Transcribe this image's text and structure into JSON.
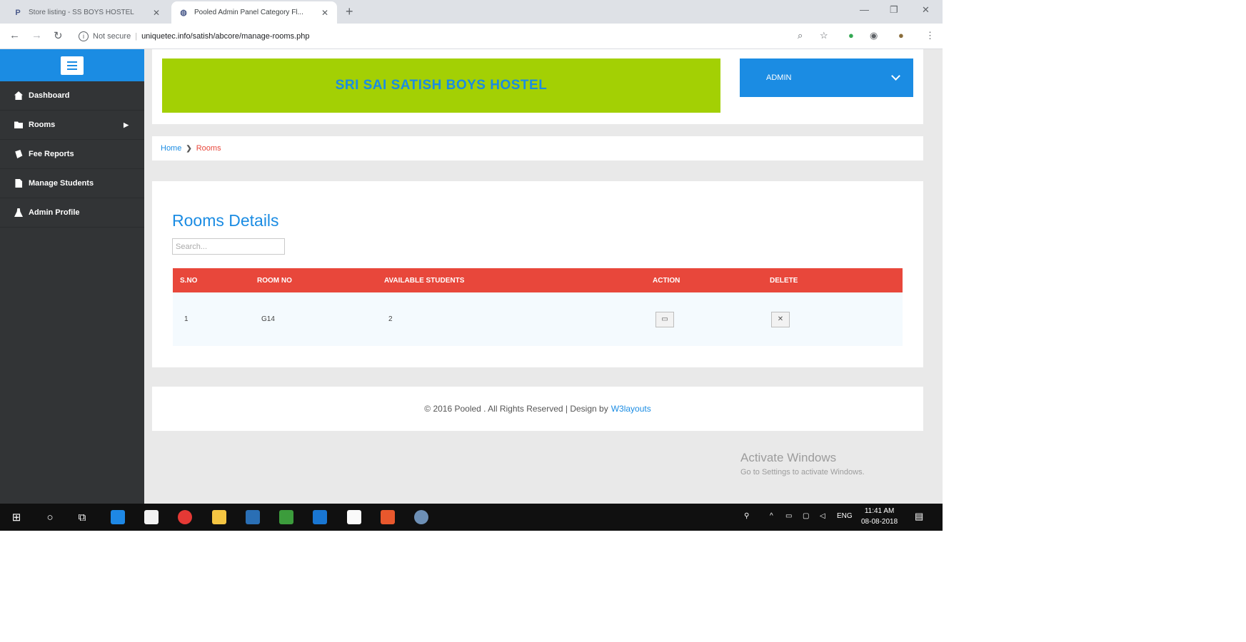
{
  "browser": {
    "tabs": [
      {
        "title": "Store listing - SS BOYS HOSTEL",
        "active": false
      },
      {
        "title": "Pooled Admin Panel Category Fl...",
        "active": true
      }
    ],
    "new_tab": "+",
    "security_label": "Not secure",
    "url": "uniquetec.info/satish/abcore/manage-rooms.php"
  },
  "sidebar": {
    "items": [
      {
        "label": "Dashboard",
        "icon": "home-icon"
      },
      {
        "label": "Rooms",
        "icon": "folder-icon",
        "has_submenu": true
      },
      {
        "label": "Fee Reports",
        "icon": "files-icon"
      },
      {
        "label": "Manage Students",
        "icon": "file-icon"
      },
      {
        "label": "Admin Profile",
        "icon": "user-icon"
      }
    ]
  },
  "header": {
    "banner_title": "SRI SAI SATISH BOYS HOSTEL",
    "admin_label": "ADMIN"
  },
  "breadcrumb": {
    "home": "Home",
    "separator": "❯",
    "current": "Rooms"
  },
  "main": {
    "title": "Rooms Details",
    "search_placeholder": "Search...",
    "table": {
      "columns": [
        "S.NO",
        "ROOM NO",
        "AVAILABLE STUDENTS",
        "ACTION",
        "DELETE"
      ],
      "rows": [
        {
          "sno": "1",
          "room_no": "G14",
          "available": "2"
        }
      ]
    }
  },
  "footer": {
    "text": "© 2016 Pooled . All Rights Reserved | Design by",
    "link": "W3layouts"
  },
  "watermark": {
    "line1": "Activate Windows",
    "line2": "Go to Settings to activate Windows."
  },
  "taskbar": {
    "language": "ENG",
    "time": "11:41 AM",
    "date": "08-08-2018"
  },
  "colors": {
    "accent_blue": "#1b8ce3",
    "banner_green": "#a3d004",
    "table_header_red": "#e8473b",
    "sidebar_dark": "#323436"
  }
}
